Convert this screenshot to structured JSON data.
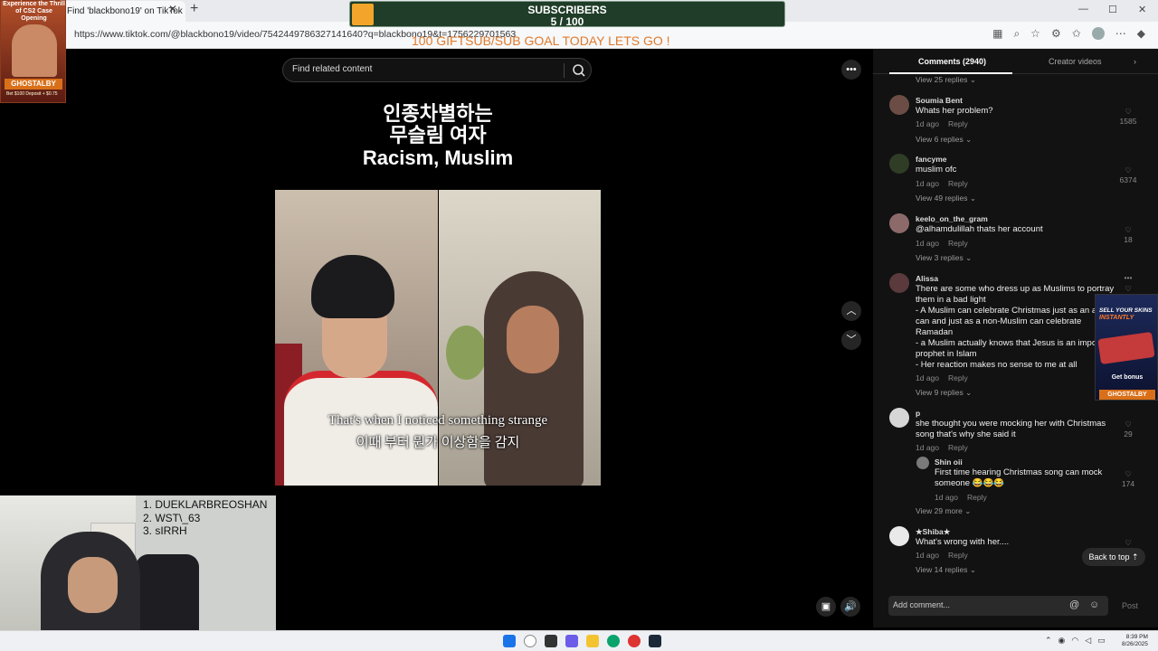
{
  "browser": {
    "tab_title": "Find 'blackbono19' on TikTok",
    "url": "https://www.tiktok.com/@blackbono19/video/7542449786327141640?q=blackbono19&t=1756229701563",
    "win_min": "—",
    "win_max": "☐",
    "win_close": "✕"
  },
  "stream": {
    "sub_title": "SUBSCRIBERS",
    "sub_count": "5 / 100",
    "sub_progress": 0.05,
    "goal_text": "100 GIFTSUB/SUB GOAL TODAY LETS GO !",
    "promo_title": "Experience the Thrill of CS2 Case Opening",
    "promo_badge": "GHOSTALBY",
    "promo_tag": "Bet $100 Deposit + $0.75",
    "leaderboard": [
      "1.  DUEKLARBREOSHAN",
      "2.  WST\\_63",
      "3.  sIRRH"
    ]
  },
  "video": {
    "search_placeholder": "Find related content",
    "overlay_kr_1": "인종차별하는",
    "overlay_kr_2": "무슬림 여자",
    "overlay_en": "Racism, Muslim",
    "subtitle_en": "That's when I noticed something strange",
    "subtitle_kr": "이때 부터 뭔가 이상함을 감지"
  },
  "comments_panel": {
    "tab_comments": "Comments (2940)",
    "tab_creator": "Creator videos",
    "top_replies": "View 25 replies",
    "items": [
      {
        "user": "Soumia Bent",
        "text": "Whats her problem?",
        "time": "1d ago",
        "reply": "Reply",
        "likes": "1585",
        "replies": "View 6 replies"
      },
      {
        "user": "fancyme",
        "text": "muslim ofc",
        "time": "1d ago",
        "reply": "Reply",
        "likes": "6374",
        "replies": "View 49 replies"
      },
      {
        "user": "keelo_on_the_gram",
        "text": "@alhamdulillah thats her account",
        "time": "1d ago",
        "reply": "Reply",
        "likes": "18",
        "replies": "View 3 replies"
      },
      {
        "user": "Alissa",
        "text": "There are some who dress up as Muslims to portray them in a bad light\n- A Muslim can celebrate Christmas just as an atheist can and just as a non-Muslim can celebrate Ramadan\n- a Muslim actually knows that Jesus is an important prophet in Islam\n- Her reaction makes no sense to me at all",
        "time": "1d ago",
        "reply": "Reply",
        "likes": "",
        "replies": "View 9 replies"
      },
      {
        "user": "p",
        "text": "she thought you were mocking her with Christmas song that's why she said it",
        "time": "1d ago",
        "reply": "Reply",
        "likes": "29",
        "replies": ""
      },
      {
        "user": "Shin oii",
        "text": "First time hearing Christmas song can mock someone 😂😂😂",
        "time": "1d ago",
        "reply": "Reply",
        "likes": "174",
        "replies": "View 29 more"
      },
      {
        "user": "★Shiba★",
        "text": "What's wrong with her....",
        "time": "1d ago",
        "reply": "Reply",
        "likes": "",
        "replies": "View 14 replies"
      }
    ],
    "back_to_top": "Back to top",
    "add_comment_placeholder": "Add comment...",
    "post": "Post"
  },
  "skin_ad": {
    "line1": "SELL YOUR SKINS",
    "line2": "INSTANTLY",
    "line3": "Get bonus",
    "badge": "GHOSTALBY"
  },
  "taskbar": {
    "time": "8:39 PM",
    "date": "8/26/2025"
  },
  "colors": {
    "accent_orange": "#f2a52a",
    "tiktok_panel": "#121212",
    "sub_bar": "#1f3d28"
  }
}
